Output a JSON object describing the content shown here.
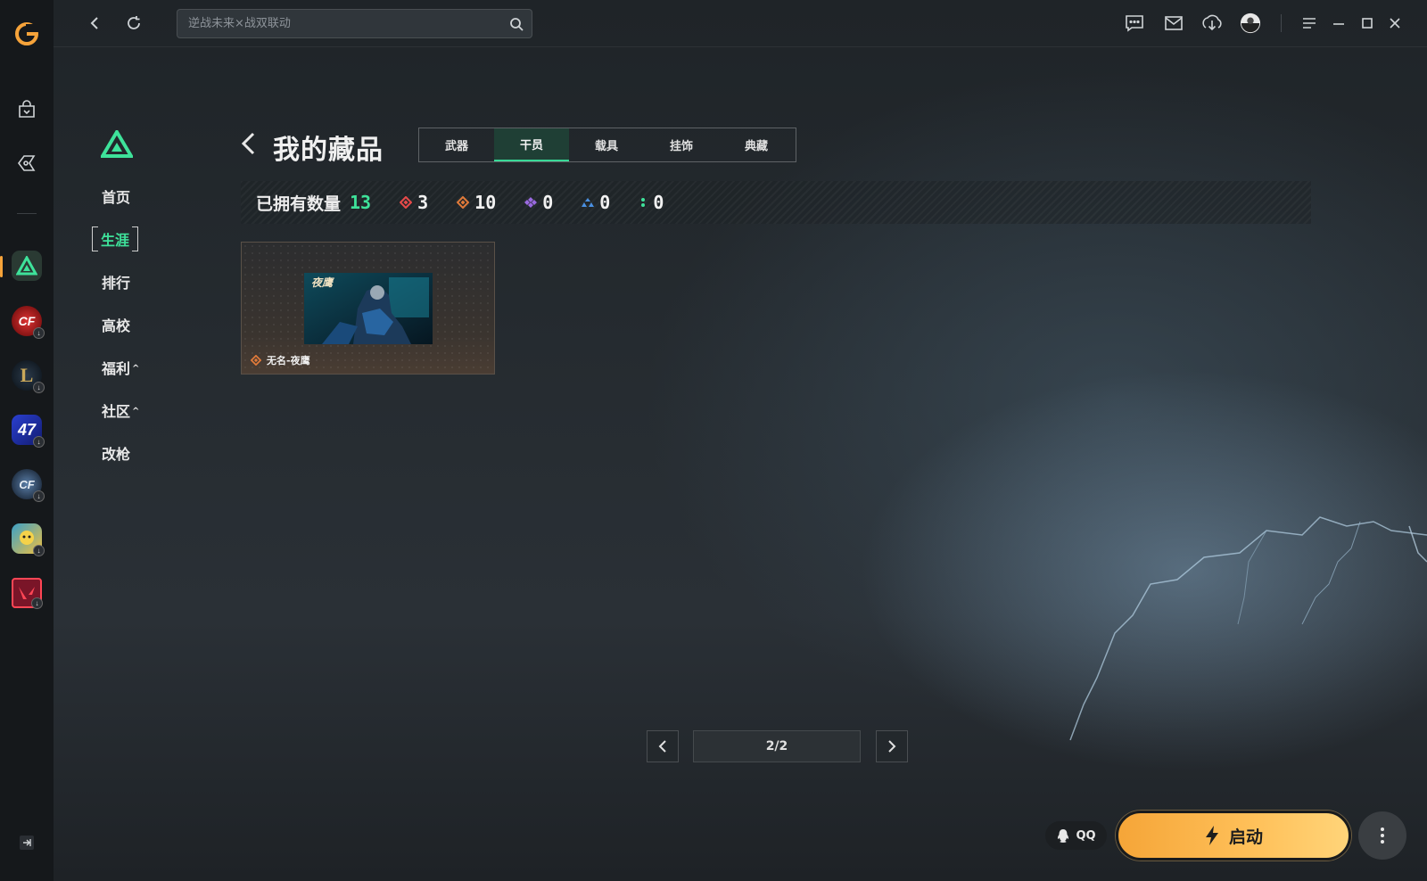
{
  "search": {
    "placeholder": "逆战未来×战双联动"
  },
  "colors": {
    "accent_green": "#3ee29a",
    "launch_orange": "#f7a93e",
    "dock_active": "#f6a33a"
  },
  "dock": {
    "icons": [
      "wegame-logo-icon",
      "shop-bag-icon",
      "tag-icon",
      "delta-force-icon",
      "crossfire-icon",
      "league-of-legends-icon",
      "game-47-icon",
      "crossfire-hd-icon",
      "roco-kingdom-icon",
      "valorant-icon",
      "expand-sidebar-icon"
    ]
  },
  "subnav": {
    "items": [
      {
        "label": "首页"
      },
      {
        "label": "生涯"
      },
      {
        "label": "排行"
      },
      {
        "label": "高校"
      },
      {
        "label": "福利",
        "caret": "^"
      },
      {
        "label": "社区",
        "caret": "^"
      },
      {
        "label": "改枪"
      }
    ]
  },
  "page": {
    "title": "我的藏品",
    "tabs": [
      {
        "label": "武器"
      },
      {
        "label": "干员"
      },
      {
        "label": "载具"
      },
      {
        "label": "挂饰"
      },
      {
        "label": "典藏"
      }
    ],
    "active_tab": "干员"
  },
  "stats": {
    "owned_label": "已拥有数量",
    "owned_total": "13",
    "rarities": [
      {
        "color": "#e84a4a",
        "count": "3"
      },
      {
        "color": "#e07a3a",
        "count": "10"
      },
      {
        "color": "#9a6ae0",
        "count": "0"
      },
      {
        "color": "#4a90e2",
        "count": "0"
      },
      {
        "color": "#3ee29a",
        "count": "0"
      }
    ]
  },
  "items": [
    {
      "name": "无名-夜鹰",
      "thumb_title": "夜鹰",
      "rarity_color": "#e07a3a"
    }
  ],
  "pager": {
    "current": "2/2"
  },
  "bottom": {
    "qq_label": "QQ",
    "launch_label": "启动"
  }
}
